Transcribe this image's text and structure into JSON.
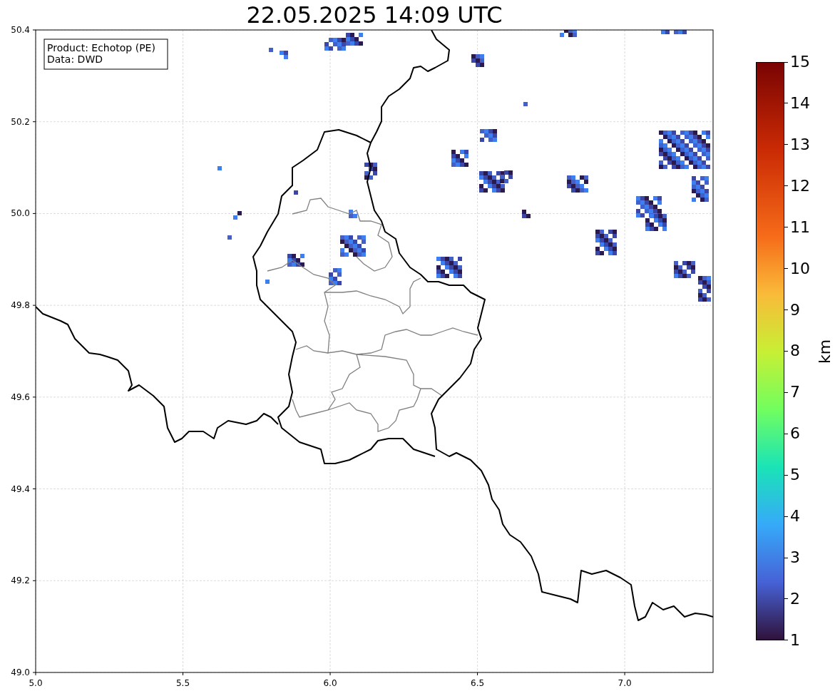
{
  "title": "22.05.2025 14:09 UTC",
  "map": {
    "info_box": [
      "Product: Echotop (PE)",
      "Data: DWD"
    ],
    "x_ticks": [
      "5.0",
      "5.5",
      "6.0",
      "6.5",
      "7.0"
    ],
    "y_ticks": [
      "50.4",
      "50.2",
      "50.0",
      "49.8",
      "49.6",
      "49.4",
      "49.2",
      "49.0"
    ]
  },
  "colorbar": {
    "label": "km",
    "ticks": [
      "15",
      "14",
      "13",
      "12",
      "11",
      "10",
      "9",
      "8",
      "7",
      "6",
      "5",
      "4",
      "3",
      "2",
      "1"
    ]
  }
}
